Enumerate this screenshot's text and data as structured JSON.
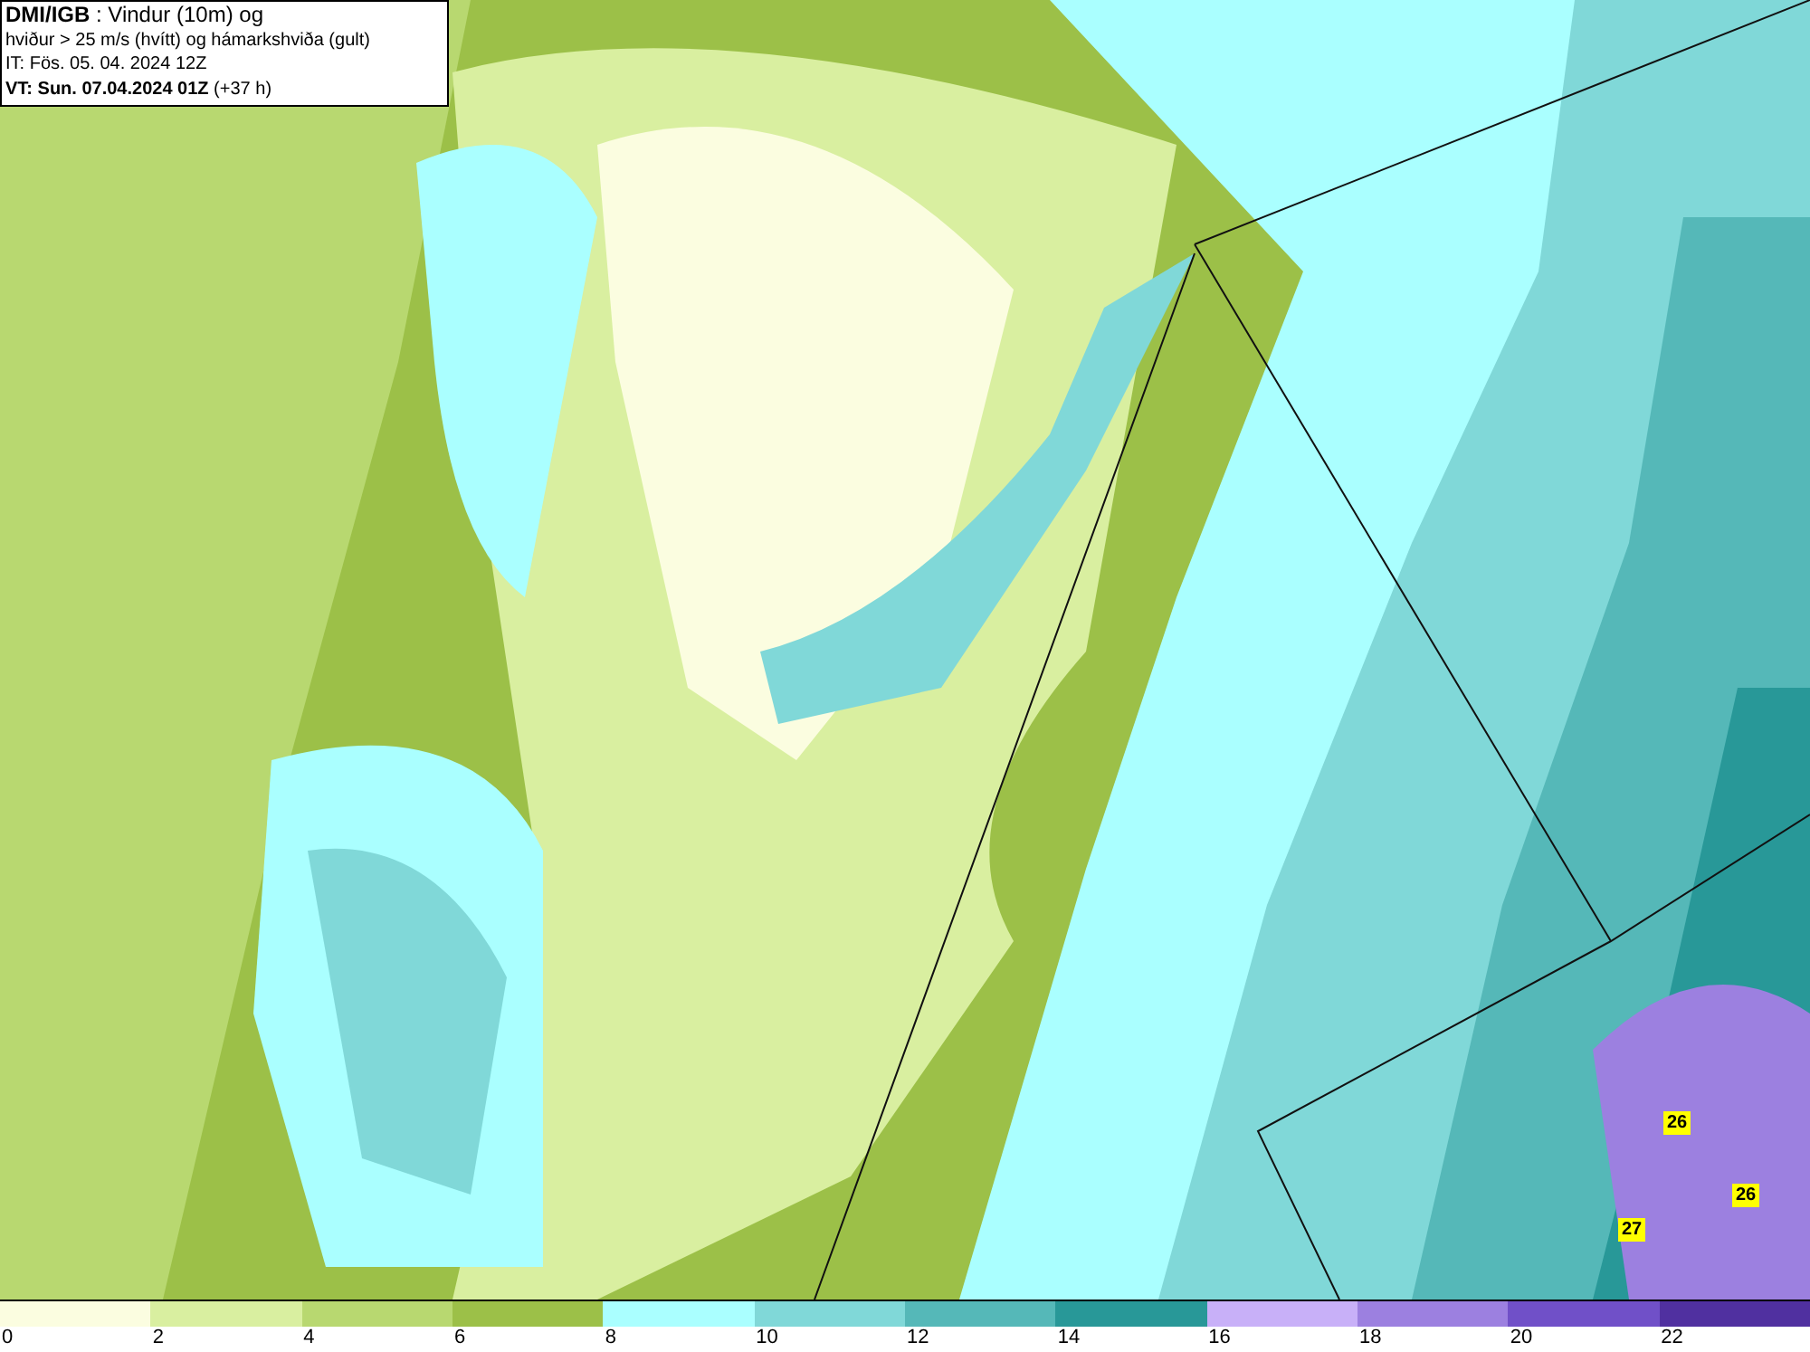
{
  "title_box": {
    "lines": [
      "**DMI/IGB** : Vindur (10m) og",
      "hviður > 25 m/s (hvítt) og hámarkshviða (gult)",
      "IT: Fös. 05. 04. 2024 12Z",
      "**VT: Sun. 07.04.2024 01Z** (+37 h)"
    ]
  },
  "gust_labels": [
    {
      "text": "26"
    },
    {
      "text": "26"
    },
    {
      "text": "27"
    }
  ],
  "legend": {
    "bins": [
      {
        "color": "#fbfde0"
      },
      {
        "color": "#d9efa0"
      },
      {
        "color": "#b8d870"
      },
      {
        "color": "#9cc048"
      },
      {
        "color": "#aaffff"
      },
      {
        "color": "#80d8d8"
      },
      {
        "color": "#55b8b8"
      },
      {
        "color": "#289898"
      },
      {
        "color": "#c8b0f8"
      },
      {
        "color": "#9c80e0"
      },
      {
        "color": "#7050c8"
      },
      {
        "color": "#5030a0"
      }
    ],
    "ticks": [
      "0",
      "2",
      "4",
      "6",
      "8",
      "10",
      "12",
      "14",
      "16",
      "18",
      "20",
      "22"
    ]
  }
}
